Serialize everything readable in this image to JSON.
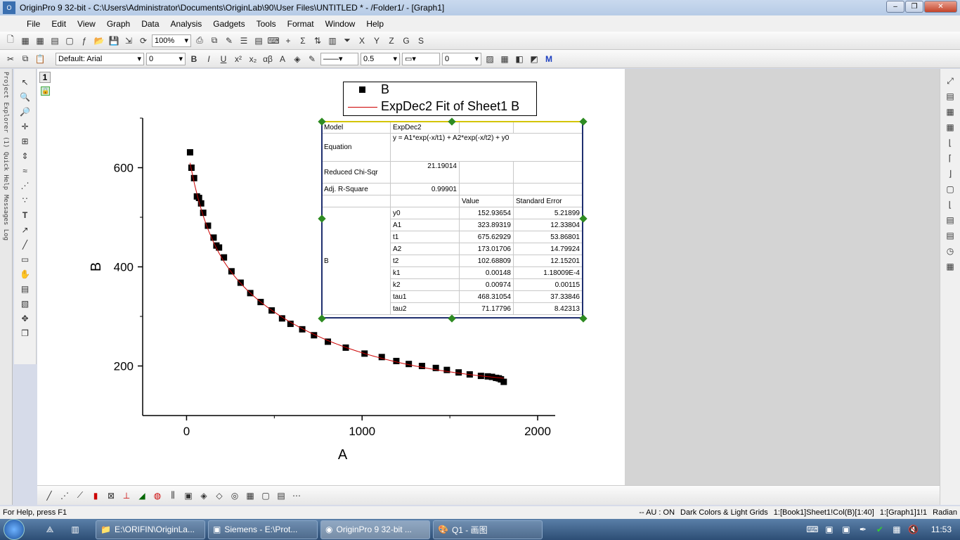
{
  "window": {
    "title": "OriginPro 9 32-bit - C:\\Users\\Administrator\\Documents\\OriginLab\\90\\User Files\\UNTITLED * - /Folder1/ - [Graph1]"
  },
  "menu": [
    "File",
    "Edit",
    "View",
    "Graph",
    "Data",
    "Analysis",
    "Gadgets",
    "Tools",
    "Format",
    "Window",
    "Help"
  ],
  "toolbar": {
    "zoom": "100%",
    "font": "Default: Arial",
    "font_size": "0",
    "line_width": "0.5",
    "fill_value": "0"
  },
  "left_tabs": [
    "Project Explorer (1)",
    "Quick Help",
    "Messages Log"
  ],
  "layer_label": "1",
  "legend": {
    "items": [
      {
        "label": "B",
        "symbol": "square"
      },
      {
        "label": "ExpDec2 Fit of Sheet1 B",
        "symbol": "line"
      }
    ]
  },
  "fit_table": {
    "model_label": "Model",
    "model": "ExpDec2",
    "equation_label": "Equation",
    "equation": "y = A1*exp(-x/t1) + A2*exp(-x/t2) + y0",
    "chisq_label": "Reduced Chi-Sqr",
    "chisq": "21.19014",
    "r2_label": "Adj. R-Square",
    "r2": "0.99901",
    "col_value": "Value",
    "col_error": "Standard Error",
    "group": "B",
    "params": [
      {
        "name": "y0",
        "value": "152.93654",
        "error": "5.21899"
      },
      {
        "name": "A1",
        "value": "323.89319",
        "error": "12.33804"
      },
      {
        "name": "t1",
        "value": "675.62929",
        "error": "53.86801"
      },
      {
        "name": "A2",
        "value": "173.01706",
        "error": "14.79924"
      },
      {
        "name": "t2",
        "value": "102.68809",
        "error": "12.15201"
      },
      {
        "name": "k1",
        "value": "0.00148",
        "error": "1.18009E-4"
      },
      {
        "name": "k2",
        "value": "0.00974",
        "error": "0.00115"
      },
      {
        "name": "tau1",
        "value": "468.31054",
        "error": "37.33846"
      },
      {
        "name": "tau2",
        "value": "71.17796",
        "error": "8.42313"
      }
    ]
  },
  "chart_data": {
    "type": "scatter",
    "xlabel": "A",
    "ylabel": "B",
    "xlim": [
      -250,
      2100
    ],
    "ylim": [
      100,
      700
    ],
    "xticks": [
      0,
      1000,
      2000
    ],
    "yticks": [
      200,
      400,
      600
    ],
    "grid": false,
    "legend": "top-right",
    "series": [
      {
        "name": "B",
        "marker": "square",
        "color": "#000000",
        "x": [
          20,
          28,
          43,
          59,
          71,
          83,
          95,
          122,
          154,
          170,
          185,
          213,
          256,
          308,
          363,
          422,
          485,
          544,
          592,
          659,
          726,
          805,
          907,
          1014,
          1112,
          1195,
          1266,
          1341,
          1420,
          1483,
          1550,
          1613,
          1677,
          1716,
          1740,
          1763,
          1779,
          1791,
          1807
        ],
        "y": [
          631,
          600,
          579,
          542,
          539,
          528,
          509,
          483,
          459,
          443,
          439,
          419,
          391,
          368,
          347,
          329,
          312,
          296,
          285,
          274,
          262,
          249,
          237,
          225,
          218,
          210,
          204,
          200,
          196,
          192,
          187,
          183,
          180,
          179,
          178,
          176,
          175,
          173,
          168
        ]
      },
      {
        "name": "ExpDec2 Fit of Sheet1 B",
        "type": "line",
        "color": "#cc0000",
        "fit": {
          "y0": 152.93654,
          "A1": 323.89319,
          "t1": 675.62929,
          "A2": 173.01706,
          "t2": 102.68809
        },
        "xrange": [
          20,
          1807
        ]
      }
    ]
  },
  "status": {
    "help": "For Help, press F1",
    "items": [
      "-- AU : ON",
      "Dark Colors & Light Grids",
      "1:[Book1]Sheet1!Col(B)[1:40]",
      "1:[Graph1]1!1",
      "Radian"
    ]
  },
  "taskbar": {
    "tasks": [
      "E:\\ORIFIN\\OriginLa...",
      "Siemens  - E:\\Prot...",
      "OriginPro 9 32-bit ...",
      "Q1 - 画图"
    ],
    "clock": "11:53"
  }
}
